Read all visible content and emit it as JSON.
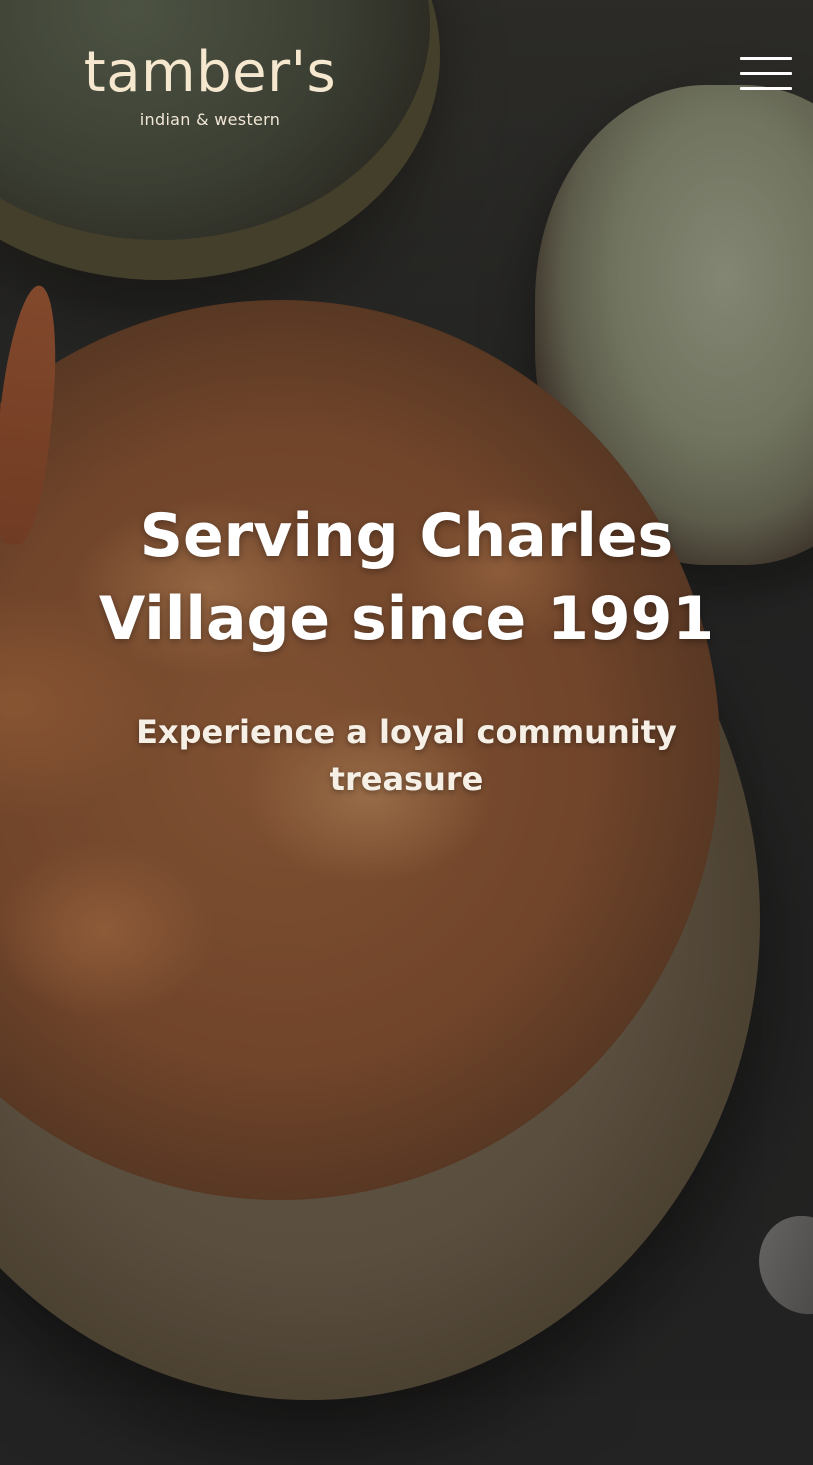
{
  "header": {
    "logo": {
      "name": "tamber's",
      "tagline": "indian & western"
    },
    "menu_icon": "hamburger-menu-icon"
  },
  "hero": {
    "title": "Serving Charles Village since 1991",
    "subtitle": "Experience a loyal community treasure"
  },
  "colors": {
    "logo_text": "#f6e8cf",
    "hero_text": "#ffffff",
    "overlay": "#141210"
  }
}
